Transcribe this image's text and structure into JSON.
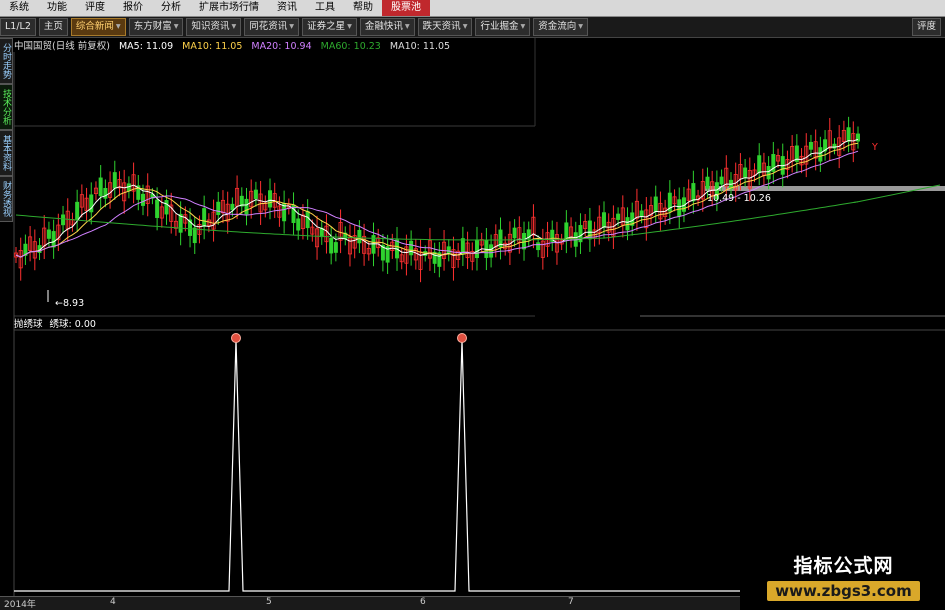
{
  "menu": [
    {
      "label": "系统"
    },
    {
      "label": "功能"
    },
    {
      "label": "评度"
    },
    {
      "label": "报价"
    },
    {
      "label": "分析"
    },
    {
      "label": "扩展市场行情"
    },
    {
      "label": "资讯"
    },
    {
      "label": "工具"
    },
    {
      "label": "帮助"
    },
    {
      "label": "股票池",
      "active": true
    }
  ],
  "toolbar": {
    "level": "L1/L2",
    "home": "主页",
    "tabs": [
      "综合新闻",
      "东方财富",
      "知识资讯",
      "同花资讯",
      "证券之星",
      "金融快讯",
      "跌天资讯",
      "行业掘金",
      "资金流向"
    ],
    "right": "评度"
  },
  "vtabs": [
    {
      "label": "分时走势"
    },
    {
      "label": "技术分析",
      "active": true
    },
    {
      "label": "基本资料"
    },
    {
      "label": "财务透视"
    }
  ],
  "info": {
    "stock": "中国国贸(日线 前复权)",
    "ma5": "MA5: 11.09",
    "ma10a": "MA10: 11.05",
    "ma20": "MA20: 10.94",
    "ma60": "MA60: 10.23",
    "ma10b": "MA10: 11.05"
  },
  "lower": {
    "label1": "抛绣球",
    "label2": "绣球: 0.00"
  },
  "annotations": {
    "low": "←8.93",
    "range": "10.49 - 10.26",
    "y_marker": "Y"
  },
  "axis": {
    "year": "2014年",
    "months": [
      "4",
      "5",
      "6",
      "7"
    ]
  },
  "watermark": {
    "title": "指标公式网",
    "url": "www.zbgs3.com"
  },
  "colors": {
    "up": "#ff3030",
    "down": "#2fd22f",
    "ma5": "#ffffff",
    "ma10": "#ffd24a",
    "ma20": "#d080ff",
    "ma60": "#2eaa2e",
    "signal": "#ffffff",
    "grid": "#3a3a3a",
    "ball": "#e05040"
  },
  "chart_data": {
    "type": "candlestick",
    "signal_peaks": [
      {
        "index": 0,
        "value": 1
      },
      {
        "index": 1,
        "value": 1
      }
    ]
  }
}
